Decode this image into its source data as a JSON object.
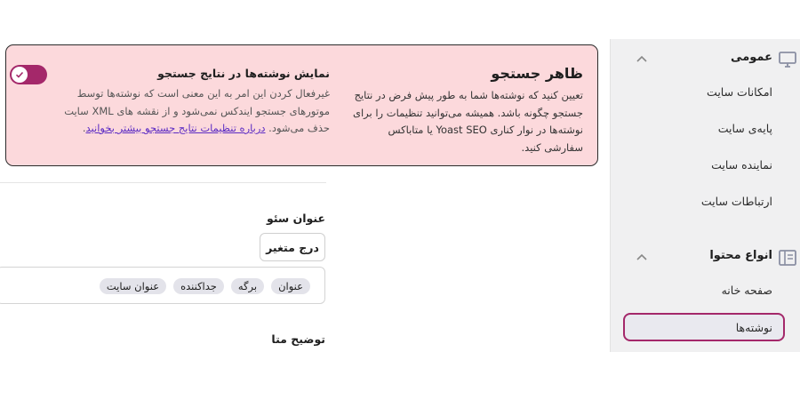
{
  "sidebar": {
    "sections": [
      {
        "title": "عمومی",
        "icon": "desktop-icon",
        "items": [
          "امکانات سایت",
          "پایه‌ی سایت",
          "نماینده سایت",
          "ارتباطات سایت"
        ]
      },
      {
        "title": "انواع محتوا",
        "icon": "content-types-icon",
        "items": [
          "صفحه خانه",
          "نوشته‌ها"
        ]
      }
    ],
    "active_item": "نوشته‌ها"
  },
  "card": {
    "title": "ظاهر جستجو",
    "description": "تعیین کنید که نوشته‌ها شما به طور پیش فرض در نتایج جستجو چگونه باشد. همیشه می‌توانید تنظیمات را برای نوشته‌ها در نوار کناری Yoast SEO یا متاباکس سفارشی کنید.",
    "option_title": "نمایش نوشته‌ها در نتایج جستجو",
    "option_description": "غیرفعال کردن این امر به این معنی است که نوشته‌ها توسط موتورهای جستجو ایندکس نمی‌شود و از نقشه های XML سایت حذف می‌شود.",
    "option_link": "درباره تنظیمات نتایج جستجو بیشتر بخوانید",
    "option_link_suffix": ".",
    "toggle_on": true
  },
  "seo_title": {
    "label": "عنوان سئو",
    "insert_variable": "درج متغیر",
    "chips": [
      "عنوان",
      "برگه",
      "جداکننده",
      "عنوان سایت"
    ]
  },
  "meta_description": {
    "label": "توضیح متا"
  },
  "colors": {
    "accent": "#a4286a",
    "card_bg": "#fcd9dc",
    "link": "#5b2bc4",
    "sidebar_bg": "#f0f0f1"
  }
}
